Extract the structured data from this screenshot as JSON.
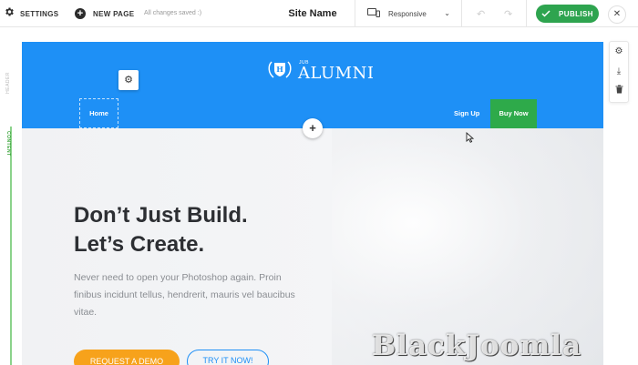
{
  "toolbar": {
    "settings_label": "SETTINGS",
    "new_page_label": "NEW PAGE",
    "saved_status": "All changes saved :)",
    "site_name": "Site Name",
    "device_select": "Responsive",
    "publish_label": "PUBLISH"
  },
  "left_rail": {
    "header_label": "HEADER",
    "content_label": "CONTENT"
  },
  "canvas": {
    "logo": {
      "small": "JUB",
      "big": "ALUMNI"
    },
    "nav": {
      "home": "Home",
      "signup": "Sign Up",
      "buy": "Buy Now"
    },
    "hero": {
      "title_line1": "Don’t Just Build.",
      "title_line2": "Let’s Create.",
      "text": "Never need to open your Photoshop again. Proin finibus incidunt tellus, hendrerit, mauris vel baucibus vitae.",
      "button_primary": "REQUEST A DEMO",
      "button_secondary": "TRY IT NOW!"
    }
  },
  "watermark": "BlackJoomla",
  "colors": {
    "header_blue": "#1e90f6",
    "buy_green": "#2eaa4a",
    "publish_green": "#2ea44f",
    "demo_orange": "#f7a21b"
  },
  "icons": [
    "gear-icon",
    "plus-circle-icon",
    "device-icon",
    "chevron-down-icon",
    "undo-icon",
    "redo-icon",
    "check-icon",
    "close-icon",
    "download-icon",
    "trash-icon",
    "pointer-cursor-icon"
  ]
}
